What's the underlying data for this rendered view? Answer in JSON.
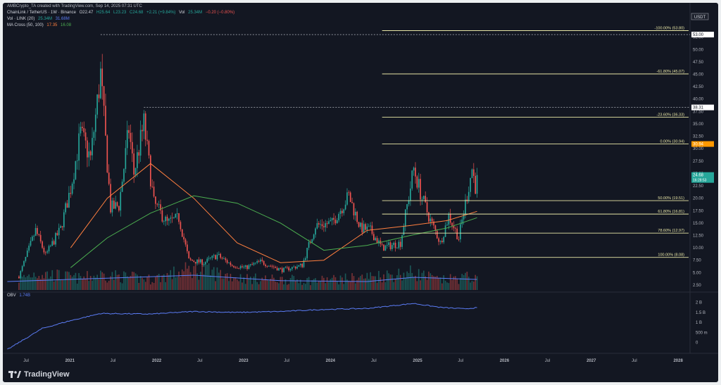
{
  "credit": "AMBCrypto_TA created with TradingView.com, Sep 14, 2025 07:31 UTC",
  "header": {
    "symbol": "ChainLink / TetherUS · 1W · Binance",
    "open": "O22.47",
    "high": "H25.64",
    "low": "L23.23",
    "close": "C24.68",
    "change": "+2.21 (+9.84%)",
    "vol_label": "Vol",
    "vol_value": "25.34M",
    "vol_change": "−0.20 (−0.80%)",
    "vol_indicator": "Vol · LINK (20)",
    "vol_indicator_v1": "25.34M",
    "vol_indicator_v2": "31.68M",
    "ma_indicator": "MA Cross (50, 100)",
    "ma_v1": "17.35",
    "ma_v2": "16.08",
    "obv_label": "OBV",
    "obv_value": "1.74B"
  },
  "brand": "TradingView",
  "colors": {
    "background": "#131722",
    "up": "#26a69a",
    "down": "#ef5350",
    "ma50": "#ff7f3f",
    "ma100": "#4caf50",
    "obv": "#5b7cf5",
    "fib": "#e8e6a6",
    "price_tag": "#26a69a",
    "fib_tag": "#ff9800",
    "grid_text": "#b2b5be"
  },
  "chart_data": {
    "type": "candlestick",
    "currency": "USDT",
    "y_ticks": [
      2.5,
      5,
      7.5,
      10,
      12.5,
      15,
      17.5,
      20,
      22.5,
      25,
      27.5,
      30,
      32.5,
      35,
      37.5,
      40,
      42.5,
      45,
      47.5,
      50,
      52.5
    ],
    "y_tick_labels": [
      "2.50",
      "5.00",
      "7.50",
      "10.00",
      "12.50",
      "15.00",
      "17.50",
      "20.00",
      "22.50",
      "25.00",
      "27.50",
      "30.00",
      "32.50",
      "35.00",
      "37.50",
      "40.00",
      "42.50",
      "45.00",
      "47.50",
      "50.00",
      "52.50"
    ],
    "ylim": [
      1.5,
      56
    ],
    "x_ticks": [
      "Jul",
      "2021",
      "Jul",
      "2022",
      "Jul",
      "2023",
      "Jul",
      "2024",
      "Jul",
      "2025",
      "Jul",
      "2026",
      "Jul",
      "2027",
      "Jul",
      "2028"
    ],
    "x_tick_dates": [
      "2020-07-01",
      "2021-01-01",
      "2021-07-01",
      "2022-01-01",
      "2022-07-01",
      "2023-01-01",
      "2023-07-01",
      "2024-01-01",
      "2024-07-01",
      "2025-01-01",
      "2025-07-01",
      "2026-01-01",
      "2026-07-01",
      "2027-01-01",
      "2027-07-01",
      "2028-01-01"
    ],
    "xlim": [
      "2020-04-06",
      "2028-02-14"
    ],
    "price_labels": [
      {
        "label": "USDT",
        "kind": "currency"
      },
      {
        "value": 53.0,
        "label": "53.00",
        "kind": "high"
      },
      {
        "value": 38.31,
        "label": "38.31",
        "kind": "high"
      },
      {
        "value": 30.94,
        "label": "30.94",
        "kind": "fib"
      },
      {
        "value": 24.68,
        "label": "24.68",
        "sub": "16:28:53",
        "kind": "price"
      }
    ],
    "dashed_highs": [
      {
        "date": "2021-05-10",
        "value": 53.0
      },
      {
        "date": "2021-11-08",
        "value": 38.31
      }
    ],
    "fib_levels": [
      {
        "label": "-100.00% (53.80)",
        "value": 53.8
      },
      {
        "label": "-61.80% (45.07)",
        "value": 45.07
      },
      {
        "label": "-23.60% (36.33)",
        "value": 36.33
      },
      {
        "label": "0.00% (30.94)",
        "value": 30.94
      },
      {
        "label": "50.00% (19.51)",
        "value": 19.51
      },
      {
        "label": "61.80% (16.81)",
        "value": 16.81
      },
      {
        "label": "78.60% (12.97)",
        "value": 12.97
      },
      {
        "label": "100.00% (8.08)",
        "value": 8.08
      }
    ],
    "fib_start_date": "2024-08-05",
    "price_anchors": [
      {
        "date": "2020-06-01",
        "value": 4.2
      },
      {
        "date": "2020-08-10",
        "value": 13.5
      },
      {
        "date": "2020-09-21",
        "value": 8.5
      },
      {
        "date": "2020-11-23",
        "value": 13.8
      },
      {
        "date": "2021-01-04",
        "value": 22.0
      },
      {
        "date": "2021-02-15",
        "value": 33.0
      },
      {
        "date": "2021-03-29",
        "value": 28.0
      },
      {
        "date": "2021-05-10",
        "value": 45.0
      },
      {
        "date": "2021-06-21",
        "value": 18.0
      },
      {
        "date": "2021-07-26",
        "value": 18.5
      },
      {
        "date": "2021-09-06",
        "value": 34.0
      },
      {
        "date": "2021-09-27",
        "value": 25.0
      },
      {
        "date": "2021-11-08",
        "value": 35.0
      },
      {
        "date": "2021-12-20",
        "value": 19.0
      },
      {
        "date": "2022-02-14",
        "value": 15.0
      },
      {
        "date": "2022-04-04",
        "value": 16.0
      },
      {
        "date": "2022-05-16",
        "value": 7.5
      },
      {
        "date": "2022-07-18",
        "value": 7.0
      },
      {
        "date": "2022-09-12",
        "value": 8.5
      },
      {
        "date": "2022-11-14",
        "value": 6.5
      },
      {
        "date": "2023-01-09",
        "value": 6.0
      },
      {
        "date": "2023-03-13",
        "value": 7.2
      },
      {
        "date": "2023-06-12",
        "value": 5.5
      },
      {
        "date": "2023-09-04",
        "value": 6.5
      },
      {
        "date": "2023-10-30",
        "value": 14.5
      },
      {
        "date": "2024-01-08",
        "value": 15.0
      },
      {
        "date": "2024-03-18",
        "value": 20.5
      },
      {
        "date": "2024-05-06",
        "value": 14.0
      },
      {
        "date": "2024-06-17",
        "value": 13.5
      },
      {
        "date": "2024-08-05",
        "value": 10.0
      },
      {
        "date": "2024-10-21",
        "value": 11.0
      },
      {
        "date": "2024-12-16",
        "value": 26.0
      },
      {
        "date": "2025-01-20",
        "value": 20.0
      },
      {
        "date": "2025-02-24",
        "value": 15.5
      },
      {
        "date": "2025-04-07",
        "value": 11.0
      },
      {
        "date": "2025-05-12",
        "value": 16.5
      },
      {
        "date": "2025-06-23",
        "value": 12.0
      },
      {
        "date": "2025-07-21",
        "value": 19.0
      },
      {
        "date": "2025-08-18",
        "value": 26.0
      },
      {
        "date": "2025-09-01",
        "value": 22.5
      },
      {
        "date": "2025-09-08",
        "value": 24.68
      }
    ],
    "ma50_anchors": [
      {
        "date": "2021-01-04",
        "value": 10.0
      },
      {
        "date": "2021-06-07",
        "value": 20.0
      },
      {
        "date": "2021-12-06",
        "value": 27.0
      },
      {
        "date": "2022-06-06",
        "value": 20.0
      },
      {
        "date": "2022-12-05",
        "value": 11.0
      },
      {
        "date": "2023-06-05",
        "value": 7.0
      },
      {
        "date": "2023-12-04",
        "value": 7.5
      },
      {
        "date": "2024-06-03",
        "value": 13.5
      },
      {
        "date": "2024-12-02",
        "value": 14.5
      },
      {
        "date": "2025-05-05",
        "value": 15.5
      },
      {
        "date": "2025-09-08",
        "value": 17.35
      }
    ],
    "ma100_anchors": [
      {
        "date": "2021-01-04",
        "value": 6.0
      },
      {
        "date": "2021-06-07",
        "value": 12.0
      },
      {
        "date": "2021-12-06",
        "value": 17.0
      },
      {
        "date": "2022-06-06",
        "value": 20.5
      },
      {
        "date": "2022-12-05",
        "value": 19.0
      },
      {
        "date": "2023-06-05",
        "value": 15.0
      },
      {
        "date": "2023-12-04",
        "value": 9.5
      },
      {
        "date": "2024-06-03",
        "value": 10.5
      },
      {
        "date": "2024-12-02",
        "value": 12.5
      },
      {
        "date": "2025-05-05",
        "value": 14.0
      },
      {
        "date": "2025-09-08",
        "value": 16.08
      }
    ],
    "obv": {
      "y_ticks": [
        0,
        0.5,
        1.0,
        1.5,
        2.0
      ],
      "y_tick_labels": [
        "0",
        "500 m",
        "1 B",
        "1.5 B",
        "2 B"
      ],
      "ylim": [
        -0.4,
        2.2
      ],
      "anchors": [
        {
          "date": "2020-04-13",
          "value": -0.35
        },
        {
          "date": "2020-09-07",
          "value": 0.7
        },
        {
          "date": "2020-12-21",
          "value": 1.05
        },
        {
          "date": "2021-05-10",
          "value": 1.45
        },
        {
          "date": "2021-12-06",
          "value": 1.42
        },
        {
          "date": "2022-06-06",
          "value": 1.55
        },
        {
          "date": "2022-12-05",
          "value": 1.5
        },
        {
          "date": "2023-06-05",
          "value": 1.55
        },
        {
          "date": "2023-12-04",
          "value": 1.65
        },
        {
          "date": "2024-06-03",
          "value": 1.7
        },
        {
          "date": "2024-12-16",
          "value": 1.95
        },
        {
          "date": "2025-04-07",
          "value": 1.75
        },
        {
          "date": "2025-07-14",
          "value": 1.68
        },
        {
          "date": "2025-09-08",
          "value": 1.74
        }
      ]
    },
    "volume": {
      "ylim": [
        0,
        100
      ],
      "anchors": [
        {
          "date": "2020-04-13",
          "value": 15
        },
        {
          "date": "2020-08-10",
          "value": 45
        },
        {
          "date": "2021-02-15",
          "value": 30
        },
        {
          "date": "2021-05-10",
          "value": 40
        },
        {
          "date": "2021-12-06",
          "value": 28
        },
        {
          "date": "2022-06-06",
          "value": 55
        },
        {
          "date": "2023-01-09",
          "value": 30
        },
        {
          "date": "2023-10-30",
          "value": 25
        },
        {
          "date": "2024-03-18",
          "value": 30
        },
        {
          "date": "2024-12-16",
          "value": 45
        },
        {
          "date": "2025-04-07",
          "value": 25
        },
        {
          "date": "2025-08-18",
          "value": 35
        },
        {
          "date": "2025-09-08",
          "value": 25
        }
      ],
      "ma_anchors": [
        {
          "date": "2020-04-13",
          "value": 20
        },
        {
          "date": "2021-06-07",
          "value": 28
        },
        {
          "date": "2022-06-06",
          "value": 35
        },
        {
          "date": "2023-06-05",
          "value": 22
        },
        {
          "date": "2024-06-03",
          "value": 20
        },
        {
          "date": "2024-12-16",
          "value": 30
        },
        {
          "date": "2025-09-08",
          "value": 25
        }
      ]
    }
  }
}
